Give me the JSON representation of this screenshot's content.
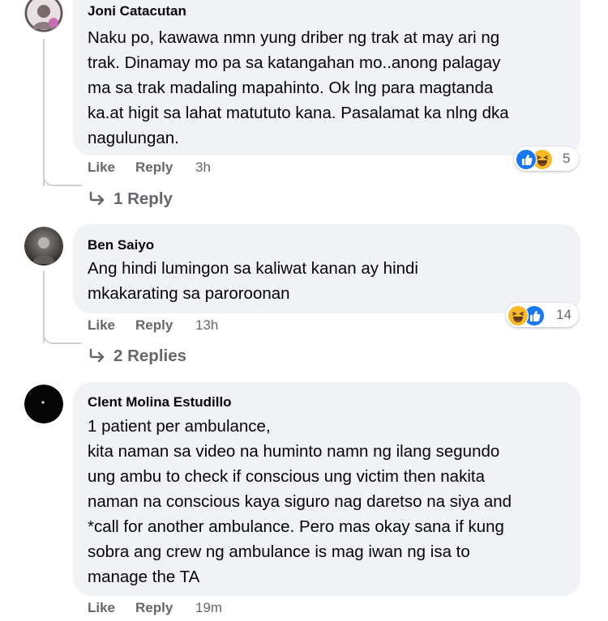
{
  "comments": [
    {
      "author": "Joni Catacutan",
      "avatar_icon": "profile-photo",
      "lines": [
        "Naku po, kawawa nmn yung driber ng trak at may ari ng",
        "trak. Dinamay mo pa sa katangahan mo..anong palagay",
        "ma sa trak madaling mapahinto. Ok lng para magtanda",
        "ka.at higit sa lahat matututo kana. Pasalamat ka nlng dka",
        "nagulungan."
      ],
      "like": "Like",
      "reply": "Reply",
      "time": "3h",
      "reactions": {
        "icons": [
          "like-icon",
          "haha-icon"
        ],
        "count": "5"
      },
      "view_replies": "1 Reply"
    },
    {
      "author": "Ben Saiyo",
      "avatar_icon": "profile-photo",
      "lines": [
        "Ang hindi lumingon sa kaliwat kanan ay hindi",
        "mkakarating sa paroroonan"
      ],
      "like": "Like",
      "reply": "Reply",
      "time": "13h",
      "reactions": {
        "icons": [
          "haha-icon",
          "like-icon"
        ],
        "count": "14"
      },
      "view_replies": "2 Replies"
    },
    {
      "author": "Clent Molina Estudillo",
      "avatar_icon": "profile-photo",
      "lines": [
        "1 patient per ambulance,",
        "kita naman sa video na huminto namn ng ilang segundo",
        "ung ambu to check if conscious ung victim then nakita",
        "naman na conscious kaya siguro nag daretso na siya and",
        "*call for another ambulance. Pero mas okay sana if kung",
        "sobra ang crew ng ambulance is mag iwan ng isa to",
        "manage the TA"
      ],
      "like": "Like",
      "reply": "Reply",
      "time": "19m"
    }
  ],
  "colors": {
    "bubble": "#f0f2f5",
    "secondary_text": "#65676b",
    "like_blue": "#1877f2",
    "haha_yellow": "#f7b928"
  }
}
